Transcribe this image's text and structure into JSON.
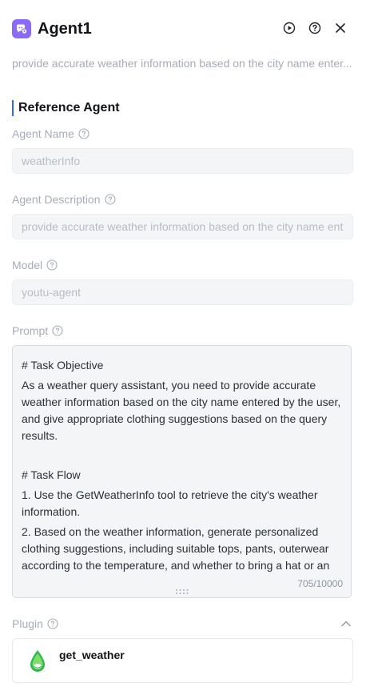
{
  "header": {
    "title": "Agent1",
    "subtitle": "provide accurate weather information based on the city name enter...",
    "app_icon": "chat-bubble-gear-icon",
    "actions": [
      {
        "icon": "play-circle-icon"
      },
      {
        "icon": "help-circle-icon"
      },
      {
        "icon": "close-icon"
      }
    ]
  },
  "reference": {
    "section_title": "Reference Agent",
    "agent_name": {
      "label": "Agent Name",
      "value": "weatherInfo"
    },
    "agent_description": {
      "label": "Agent Description",
      "value": "provide accurate weather information based on the city name ent"
    },
    "model": {
      "label": "Model",
      "value": "youtu-agent"
    },
    "prompt": {
      "label": "Prompt",
      "heading1": "# Task Objective",
      "para1": "As a weather query assistant, you need to provide accurate weather information based on the city name entered by the user, and give appropriate clothing suggestions based on the query results.",
      "heading2": "# Task Flow",
      "step1": "1. Use the GetWeatherInfo tool to retrieve the city's weather information.",
      "step2": "2. Based on the weather information, generate personalized clothing suggestions, including suitable tops, pants, outerwear according to the temperature, and whether to bring a hat or an",
      "char_count": "705/10000"
    },
    "plugin": {
      "label": "Plugin",
      "items": [
        {
          "name": "get_weather",
          "icon": "weather-drop-icon"
        }
      ]
    }
  },
  "colors": {
    "accent": "#3d63f5",
    "app_icon_bg": "#8a6cf4",
    "plugin_green": "#2fb84a"
  }
}
